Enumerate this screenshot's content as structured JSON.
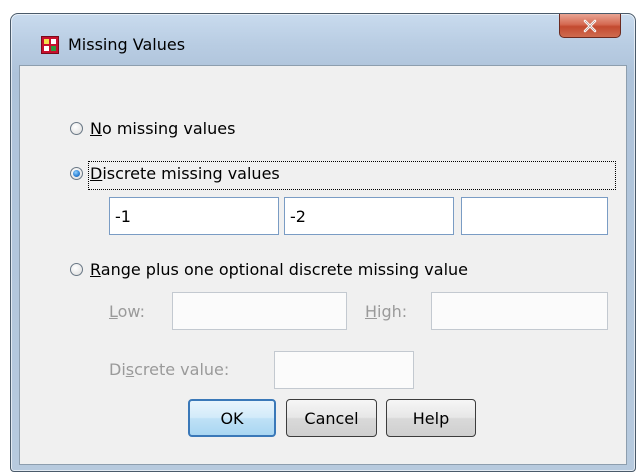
{
  "window": {
    "title": "Missing Values"
  },
  "options": {
    "no_missing": {
      "pre": "",
      "key": "N",
      "post": "o missing values",
      "selected": false
    },
    "discrete": {
      "pre": "",
      "key": "D",
      "post": "iscrete missing values",
      "selected": true
    },
    "range": {
      "pre": "",
      "key": "R",
      "post": "ange plus one optional discrete missing value",
      "selected": false
    }
  },
  "discrete_fields": {
    "field1": "-1",
    "field2": "-2",
    "field3": ""
  },
  "range_fields": {
    "low_key": "L",
    "low_post": "ow:",
    "high_key": "H",
    "high_post": "igh:",
    "discrete_pre": "Di",
    "discrete_key": "s",
    "discrete_post": "crete value:",
    "low_value": "",
    "high_value": "",
    "discrete_value": ""
  },
  "buttons": {
    "ok": "OK",
    "cancel": "Cancel",
    "help": "Help"
  },
  "colors": {
    "accent": "#3a78b8",
    "close_button": "#c34a30",
    "disabled_text": "#9a9a9a"
  }
}
